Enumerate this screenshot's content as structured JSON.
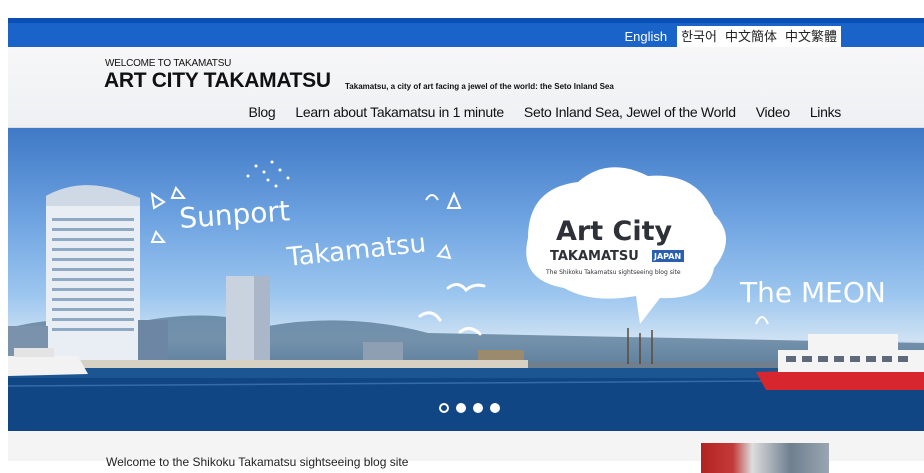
{
  "languages": [
    {
      "label": "English",
      "active": true
    },
    {
      "label": "한국어",
      "active": false
    },
    {
      "label": "中文簡体",
      "active": false
    },
    {
      "label": "中文繁體",
      "active": false
    }
  ],
  "header": {
    "welcome": "WELCOME TO TAKAMATSU",
    "title": "ART CITY TAKAMATSU",
    "tagline": "Takamatsu, a city of art facing a jewel of the world: the Seto Inland Sea"
  },
  "nav": [
    "Blog",
    "Learn about Takamatsu in 1 minute",
    "Seto Inland Sea, Jewel of the World",
    "Video",
    "Links"
  ],
  "hero": {
    "sunport_line1": "Sunport",
    "sunport_line2": "Takamatsu",
    "logo_art_city": "Art City",
    "logo_takamatsu": "TAKAMATSU",
    "logo_japan": "JAPAN",
    "logo_sub": "The Shikoku Takamatsu sightseeing blog site",
    "meon": "The MEON",
    "slide_count": 4,
    "active_slide": 1
  },
  "content": {
    "intro": "Welcome to the Shikoku Takamatsu sightseeing blog site"
  },
  "colors": {
    "lang_bar": "#1a63c9",
    "ferry_red": "#d8262f"
  }
}
